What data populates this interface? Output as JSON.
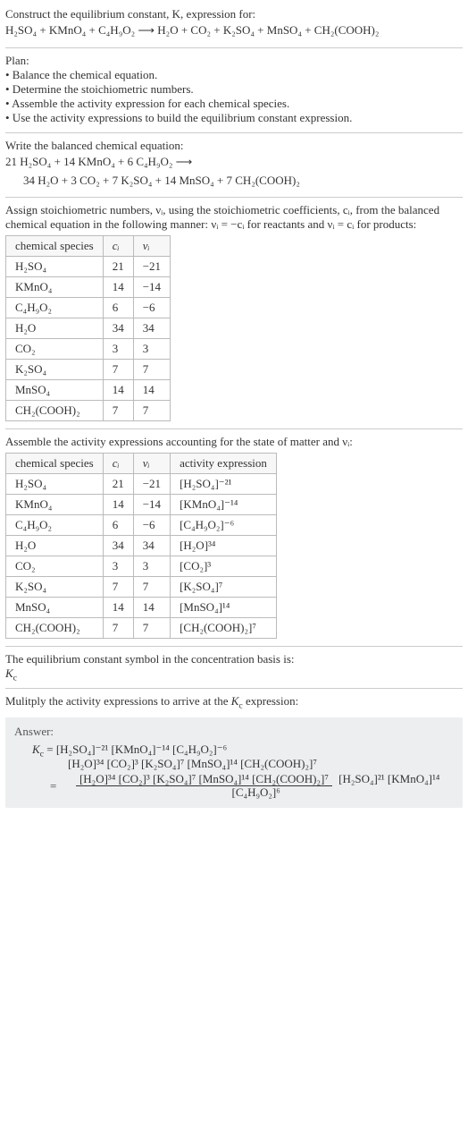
{
  "intro": {
    "line1": "Construct the equilibrium constant, K, expression for:",
    "eq_left": "H₂SO₄ + KMnO₄ + C₄H₉O₂",
    "eq_arrow": "⟶",
    "eq_right": "H₂O + CO₂ + K₂SO₄ + MnSO₄ + CH₂(COOH)₂"
  },
  "plan": {
    "title": "Plan:",
    "items": [
      "• Balance the chemical equation.",
      "• Determine the stoichiometric numbers.",
      "• Assemble the activity expression for each chemical species.",
      "• Use the activity expressions to build the equilibrium constant expression."
    ]
  },
  "balanced": {
    "title": "Write the balanced chemical equation:",
    "line1": "21 H₂SO₄ + 14 KMnO₄ + 6 C₄H₉O₂  ⟶",
    "line2": "34 H₂O + 3 CO₂ + 7 K₂SO₄ + 14 MnSO₄ + 7 CH₂(COOH)₂"
  },
  "assign": {
    "text": "Assign stoichiometric numbers, νᵢ, using the stoichiometric coefficients, cᵢ, from the balanced chemical equation in the following manner: νᵢ = −cᵢ for reactants and νᵢ = cᵢ for products:"
  },
  "table1": {
    "headers": [
      "chemical species",
      "cᵢ",
      "νᵢ"
    ],
    "rows": [
      [
        "H₂SO₄",
        "21",
        "−21"
      ],
      [
        "KMnO₄",
        "14",
        "−14"
      ],
      [
        "C₄H₉O₂",
        "6",
        "−6"
      ],
      [
        "H₂O",
        "34",
        "34"
      ],
      [
        "CO₂",
        "3",
        "3"
      ],
      [
        "K₂SO₄",
        "7",
        "7"
      ],
      [
        "MnSO₄",
        "14",
        "14"
      ],
      [
        "CH₂(COOH)₂",
        "7",
        "7"
      ]
    ]
  },
  "assemble": {
    "text": "Assemble the activity expressions accounting for the state of matter and νᵢ:"
  },
  "table2": {
    "headers": [
      "chemical species",
      "cᵢ",
      "νᵢ",
      "activity expression"
    ],
    "rows": [
      [
        "H₂SO₄",
        "21",
        "−21",
        "[H₂SO₄]⁻²¹"
      ],
      [
        "KMnO₄",
        "14",
        "−14",
        "[KMnO₄]⁻¹⁴"
      ],
      [
        "C₄H₉O₂",
        "6",
        "−6",
        "[C₄H₉O₂]⁻⁶"
      ],
      [
        "H₂O",
        "34",
        "34",
        "[H₂O]³⁴"
      ],
      [
        "CO₂",
        "3",
        "3",
        "[CO₂]³"
      ],
      [
        "K₂SO₄",
        "7",
        "7",
        "[K₂SO₄]⁷"
      ],
      [
        "MnSO₄",
        "14",
        "14",
        "[MnSO₄]¹⁴"
      ],
      [
        "CH₂(COOH)₂",
        "7",
        "7",
        "[CH₂(COOH)₂]⁷"
      ]
    ]
  },
  "symbol": {
    "line1": "The equilibrium constant symbol in the concentration basis is:",
    "line2": "K_c"
  },
  "multiply": {
    "text": "Mulitply the activity expressions to arrive at the K_c expression:"
  },
  "answer": {
    "label": "Answer:",
    "kc": "K_c =",
    "prod_line1": "[H₂SO₄]⁻²¹ [KMnO₄]⁻¹⁴ [C₄H₉O₂]⁻⁶",
    "prod_line2": "[H₂O]³⁴ [CO₂]³ [K₂SO₄]⁷ [MnSO₄]¹⁴ [CH₂(COOH)₂]⁷",
    "frac_num": "[H₂O]³⁴ [CO₂]³ [K₂SO₄]⁷ [MnSO₄]¹⁴ [CH₂(COOH)₂]⁷",
    "frac_den": "[H₂SO₄]²¹ [KMnO₄]¹⁴ [C₄H₉O₂]⁶",
    "eq": "="
  }
}
